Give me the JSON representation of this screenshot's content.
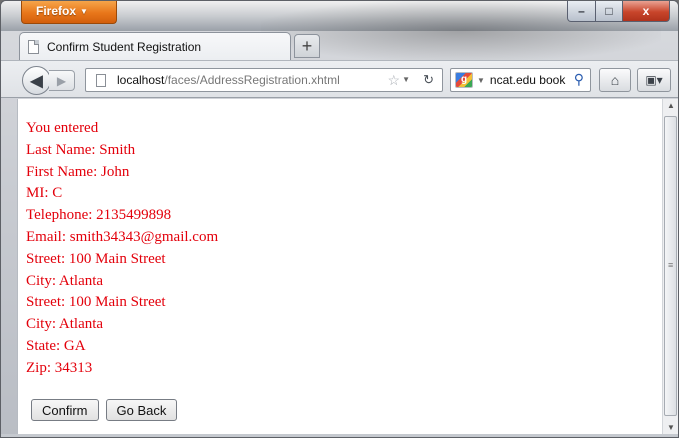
{
  "browser": {
    "app_button_label": "Firefox",
    "window_controls": {
      "minimize": "–",
      "maximize": "□",
      "close": "x"
    },
    "tab": {
      "title": "Confirm Student Registration"
    },
    "new_tab_label": "+",
    "url": {
      "host": "localhost",
      "path": "/faces/AddressRegistration.xhtml"
    },
    "search": {
      "engine_icon": "google-icon",
      "query": "ncat.edu book"
    }
  },
  "page": {
    "lines": [
      "You entered",
      "Last Name: Smith",
      "First Name: John",
      "MI: C",
      "Telephone: 2135499898",
      "Email: smith34343@gmail.com",
      "Street: 100 Main Street",
      "City: Atlanta",
      "Street: 100 Main Street",
      "City: Atlanta",
      "State: GA",
      "Zip: 34313"
    ],
    "buttons": {
      "confirm": "Confirm",
      "go_back": "Go Back"
    },
    "text_color": "#e3000b"
  }
}
